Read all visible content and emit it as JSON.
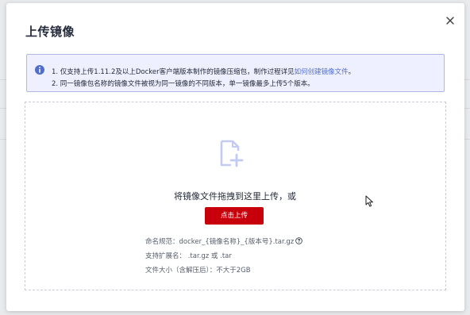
{
  "dialog": {
    "title": "上传镜像",
    "close_icon": "close-icon"
  },
  "notice": {
    "icon": "info-icon",
    "line1_prefix": "1. 仅支持上传1.11.2及以上Docker客户端版本制作的镜像压缩包，制作过程详见",
    "line1_link": "如何创建镜像文件",
    "line1_suffix": "。",
    "line2": "2. 同一镜像包名称的镜像文件被视为同一镜像的不同版本，单一镜像最多上传5个版本。"
  },
  "dropzone": {
    "icon": "file-add-icon",
    "drag_text": "将镜像文件拖拽到这里上传，或",
    "upload_button": "点击上传",
    "naming_rule": "命名规范：docker_{镜像名称}_{版本号}.tar.gz",
    "extensions": "支持扩展名： .tar.gz 或 .tar",
    "size_limit": "文件大小（含解压后）：不大于2GB"
  },
  "colors": {
    "accent": "#c7000b",
    "link": "#526ecc",
    "notice_bg": "#eef0ff",
    "notice_border": "#b0b6e8"
  }
}
